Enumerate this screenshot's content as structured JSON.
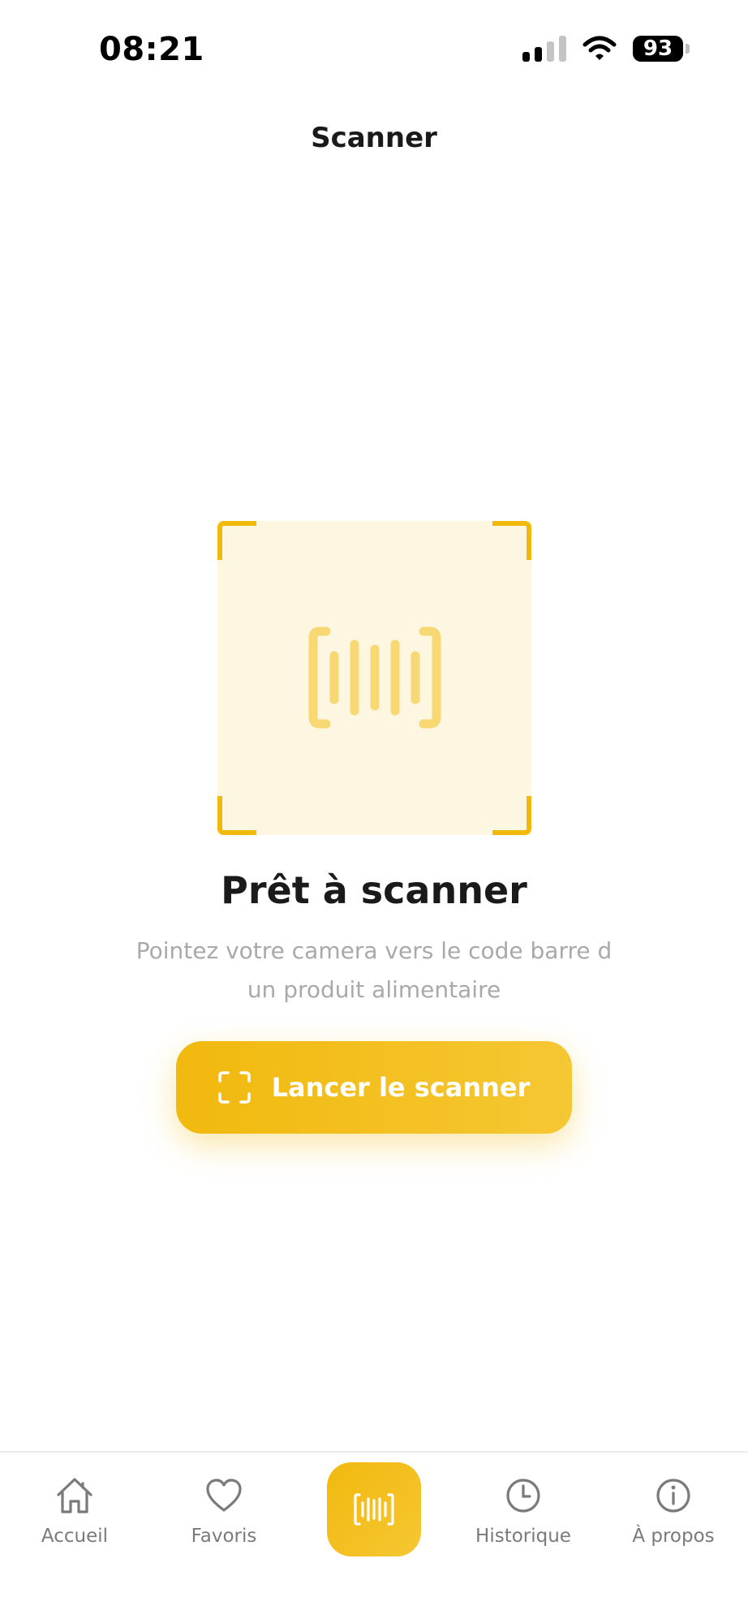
{
  "status_bar": {
    "time": "08:21",
    "battery": "93"
  },
  "header": {
    "title": "Scanner"
  },
  "scanner": {
    "ready_title": "Prêt à scanner",
    "subtitle_line1": "Pointez votre camera vers le code barre d",
    "subtitle_line2": "un produit alimentaire",
    "button_label": "Lancer le scanner"
  },
  "tab_bar": {
    "home_label": "Accueil",
    "favorites_label": "Favoris",
    "history_label": "Historique",
    "about_label": "À propos",
    "active_tab": "scanner"
  },
  "colors": {
    "accent": "#f2b90e",
    "frame_background": "#fdf7e1",
    "muted_text": "#a9a9a9",
    "tab_text": "#7a7a7a"
  },
  "icons": {
    "home": "home-icon",
    "favorites": "heart-icon",
    "scan": "barcode-icon",
    "history": "clock-icon",
    "about": "info-icon"
  }
}
